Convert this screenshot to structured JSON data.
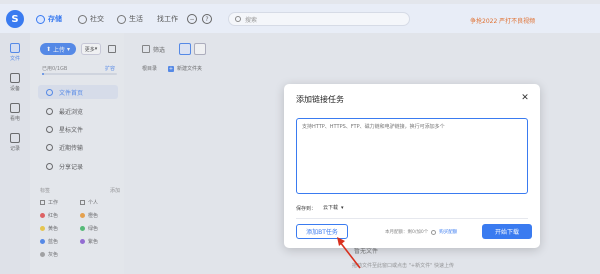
{
  "colors": {
    "accent": "#3a7bf0",
    "promo": "#e07030",
    "arrow": "#d9301e"
  },
  "header": {
    "logo_glyph": "S",
    "nav": [
      {
        "label": "存储",
        "icon": "cloud-icon",
        "active": true
      },
      {
        "label": "社交",
        "icon": "chat-icon",
        "active": false
      },
      {
        "label": "生活",
        "icon": "heart-icon",
        "active": false
      },
      {
        "label": "找工作",
        "icon": "briefcase-icon",
        "active": false
      }
    ],
    "search_placeholder": "搜索",
    "promo_text": "争抢2022 严打不良视频"
  },
  "rail": [
    {
      "label": "文件",
      "icon": "file-icon",
      "active": true
    },
    {
      "label": "设备",
      "icon": "device-icon",
      "active": false
    },
    {
      "label": "看电",
      "icon": "play-icon",
      "active": false
    },
    {
      "label": "记录",
      "icon": "edit-icon",
      "active": false
    }
  ],
  "sidebar": {
    "upload_label": "上传",
    "more_label": "更多",
    "storage_text": "已用0/1GB",
    "storage_fraction": 0.02,
    "expand_label": "扩容",
    "menu": [
      {
        "label": "文件首页",
        "active": true
      },
      {
        "label": "最近浏览",
        "active": false
      },
      {
        "label": "星标文件",
        "active": false
      },
      {
        "label": "近期传输",
        "active": false
      },
      {
        "label": "分享记录",
        "active": false
      }
    ],
    "tags_header": "标签",
    "tags_action": "添加",
    "tags": [
      {
        "label": "工作",
        "color": ""
      },
      {
        "label": "个人",
        "color": ""
      },
      {
        "label": "红色",
        "color": "#e84a4a"
      },
      {
        "label": "橙色",
        "color": "#f29a2e"
      },
      {
        "label": "黄色",
        "color": "#f2c830"
      },
      {
        "label": "绿色",
        "color": "#3cba63"
      },
      {
        "label": "蓝色",
        "color": "#3a7bf0"
      },
      {
        "label": "紫色",
        "color": "#8a58d6"
      },
      {
        "label": "灰色",
        "color": "#9a9a9a"
      }
    ]
  },
  "main": {
    "filter_label": "筛选",
    "dir_label": "根目录",
    "new_folder_label": "新建文件夹",
    "empty_title": "暂无文件",
    "empty_hint": "拖动文件至此窗口或点击 \"+新文件\" 快速上传"
  },
  "modal": {
    "title": "添加链接任务",
    "textarea_placeholder": "支持HTTP、HTTPS、FTP、磁力链和电驴链接，换行可添加多个",
    "save_to_label": "保存到：",
    "save_to_value": "云下载",
    "bt_button": "添加BT任务",
    "quota_text": "本月配额：剩0/加0个",
    "quota_link": "购买配额",
    "start_button": "开始下载"
  }
}
